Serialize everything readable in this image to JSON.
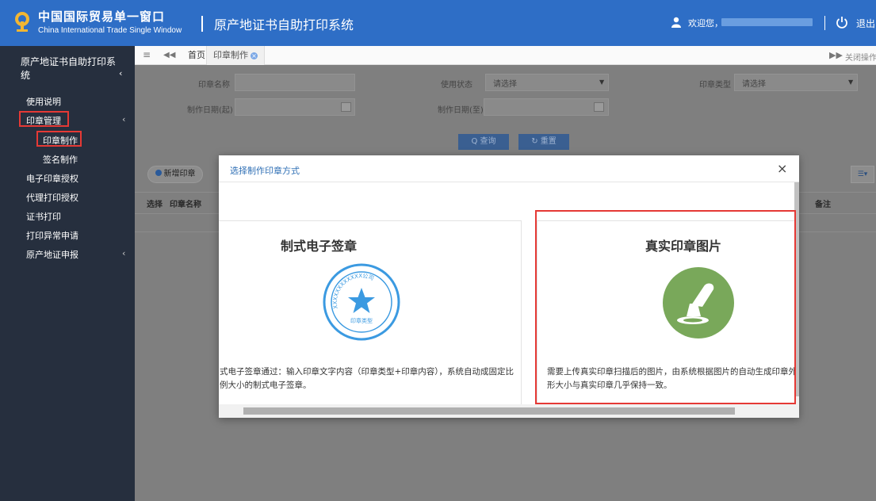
{
  "header": {
    "brand_cn": "中国国际贸易单一窗口",
    "brand_en": "China International Trade Single Window",
    "system_title": "原产地证书自助打印系统",
    "welcome": "欢迎您，",
    "logout": "退出",
    "bg_color": "#2e6ec6"
  },
  "sidebar": {
    "title": "原产地证书自助打印系统",
    "items": [
      {
        "label": "使用说明"
      },
      {
        "label": "印章管理",
        "expanded": true
      },
      {
        "label": "印章制作",
        "active": true
      },
      {
        "label": "签名制作"
      },
      {
        "label": "电子印章授权"
      },
      {
        "label": "代理打印授权"
      },
      {
        "label": "证书打印"
      },
      {
        "label": "打印异常申请"
      },
      {
        "label": "原产地证申报"
      }
    ]
  },
  "tabs": {
    "home": "首页",
    "active": "印章制作",
    "close_ops": "关闭操作"
  },
  "filters": {
    "seal_name_label": "印章名称",
    "status_label": "使用状态",
    "status_value": "请选择",
    "type_label": "印章类型",
    "type_value": "请选择",
    "date_from_label": "制作日期(起)",
    "date_to_label": "制作日期(至)",
    "query_btn": "Q 查询",
    "reset_btn": "↻ 重置"
  },
  "table": {
    "add_btn": "新增印章",
    "columns": [
      "选择",
      "印章名称",
      "备注"
    ]
  },
  "modal": {
    "title": "选择制作印章方式",
    "option_standard": {
      "title": "制式电子签章",
      "seal_ring_text": "XXXXXXXXXXXX公司",
      "seal_center_text": "印章类型",
      "desc": "式电子签章通过：输入印章文字内容（印章类型+印章内容），系统自动成固定比例大小的制式电子签章。"
    },
    "option_real": {
      "title": "真实印章图片",
      "desc": "需要上传真实印章扫描后的图片，由系统根据图片的自动生成印章外形大小与真实印章几乎保持一致。"
    }
  },
  "colors": {
    "highlight_red": "#e53935",
    "seal_blue": "#3b9ae1",
    "stamp_green": "#79a85a"
  }
}
